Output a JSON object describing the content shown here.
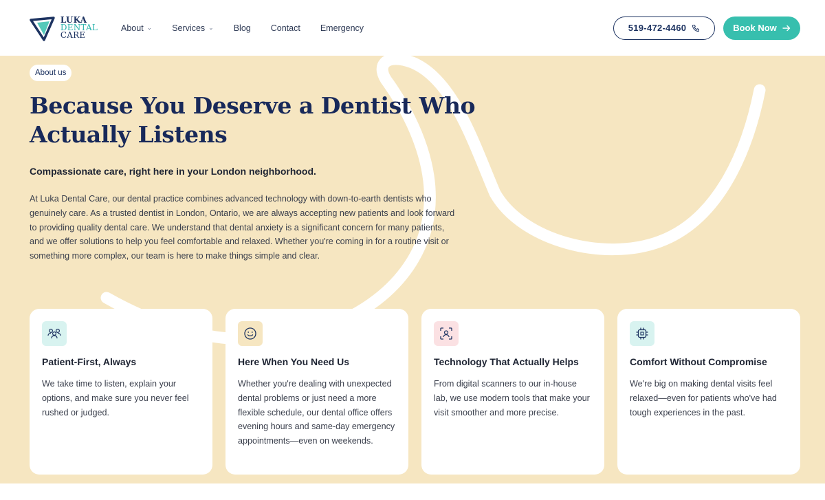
{
  "brand": {
    "line1": "LUKA",
    "line2": "DENTAL",
    "line3": "CARE",
    "colors": {
      "navy": "#1d3361",
      "teal": "#37bfae",
      "cream": "#f6e6c1"
    }
  },
  "nav": {
    "items": [
      {
        "label": "About",
        "has_dropdown": true
      },
      {
        "label": "Services",
        "has_dropdown": true
      },
      {
        "label": "Blog",
        "has_dropdown": false
      },
      {
        "label": "Contact",
        "has_dropdown": false
      },
      {
        "label": "Emergency",
        "has_dropdown": false
      }
    ]
  },
  "header_actions": {
    "phone_label": "519-472-4460",
    "phone_icon": "phone-icon",
    "book_label": "Book Now",
    "book_icon": "arrow-right-icon"
  },
  "hero": {
    "pill": "About us",
    "title": "Because You Deserve a Dentist Who Actually Listens",
    "subtitle": "Compassionate care, right here in your London neighborhood.",
    "body": "At Luka Dental Care, our dental practice combines advanced technology with down-to-earth dentists who genuinely care. As a trusted dentist in London, Ontario, we are always accepting new patients and look forward to providing quality dental care. We understand that dental anxiety is a significant concern for many patients, and we offer solutions to help you feel comfortable and relaxed. Whether you're coming in for a routine visit or something more complex, our team is here to make things simple and clear."
  },
  "cards": [
    {
      "icon": "people-icon",
      "icon_bg": "#d8f3f0",
      "title": "Patient-First, Always",
      "text": "We take time to listen, explain your options, and make sure you never feel rushed or judged."
    },
    {
      "icon": "smile-icon",
      "icon_bg": "#f6e6c1",
      "title": "Here When You Need Us",
      "text": "Whether you're dealing with unexpected dental problems or just need a more flexible schedule, our dental office offers evening hours and same-day emergency appointments—even on weekends."
    },
    {
      "icon": "face-scan-icon",
      "icon_bg": "#fbe1e3",
      "title": "Technology That Actually Helps",
      "text": "From digital scanners to our in-house lab, we use modern tools that make your visit smoother and more precise."
    },
    {
      "icon": "chip-icon",
      "icon_bg": "#d8f3f0",
      "title": "Comfort Without Compromise",
      "text": "We're big on making dental visits feel relaxed—even for patients who've had tough experiences in the past."
    }
  ]
}
